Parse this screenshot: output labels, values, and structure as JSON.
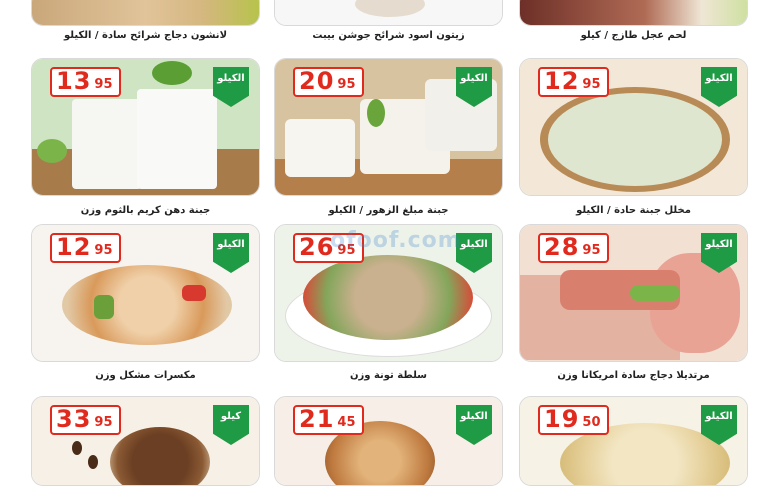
{
  "top_row": [
    {
      "title": "لحم عجل طازج / كيلو"
    },
    {
      "title": "زيتون اسود شرائح جوشن بيبت"
    },
    {
      "title": "لانشون دجاج شرائح سادة / الكيلو"
    }
  ],
  "products": [
    {
      "title": "مخلل جبنة حادة / الكيلو",
      "price_int": "12",
      "price_dec": "95",
      "badge": "الكيلو",
      "colors": {
        "bg": "#efe2d0",
        "main": "#dfe6cf"
      }
    },
    {
      "title": "جبنة مبلغ الزهور / الكيلو",
      "price_int": "20",
      "price_dec": "95",
      "badge": "الكيلو",
      "colors": {
        "bg": "#d9c4a2",
        "main": "#f4f3ee"
      }
    },
    {
      "title": "جبنة دهن كريم بالثوم وزن",
      "price_int": "13",
      "price_dec": "95",
      "badge": "الكيلو",
      "colors": {
        "bg": "#cfe5c1",
        "main": "#f7f7f4"
      }
    },
    {
      "title": "مرتديلا دجاج سادة امريكانا وزن",
      "price_int": "28",
      "price_dec": "95",
      "badge": "الكيلو",
      "colors": {
        "bg": "#f2ddd0",
        "main": "#e6b6a6"
      }
    },
    {
      "title": "سلطة تونة وزن",
      "price_int": "26",
      "price_dec": "95",
      "badge": "الكيلو",
      "colors": {
        "bg": "#e8efe4",
        "main": "#cfc1a8"
      }
    },
    {
      "title": "مكسرات مشكل وزن",
      "price_int": "12",
      "price_dec": "95",
      "badge": "الكيلو",
      "colors": {
        "bg": "#f6f3ee",
        "main": "#e5c29a"
      }
    },
    {
      "title": "",
      "price_int": "19",
      "price_dec": "50",
      "badge": "الكيلو",
      "colors": {
        "bg": "#f6f1e4",
        "main": "#e9d8a8"
      }
    },
    {
      "title": "",
      "price_int": "21",
      "price_dec": "45",
      "badge": "الكيلو",
      "colors": {
        "bg": "#f7efe7",
        "main": "#c98a52"
      }
    },
    {
      "title": "",
      "price_int": "33",
      "price_dec": "95",
      "badge": "كيلو",
      "colors": {
        "bg": "#f7f0e7",
        "main": "#7a4a2a"
      }
    }
  ],
  "watermark": "ofoof.com"
}
